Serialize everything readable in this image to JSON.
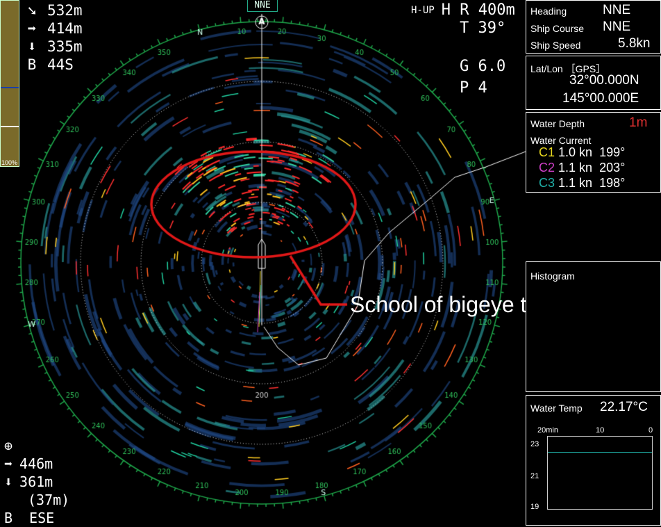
{
  "top_left": {
    "rows": [
      {
        "icon": "diag-arrow-icon",
        "glyph": "➘",
        "value": "532m"
      },
      {
        "icon": "right-arrow-icon",
        "glyph": "➡",
        "value": "414m"
      },
      {
        "icon": "down-arrow-icon",
        "glyph": "⬇",
        "value": "335m"
      },
      {
        "icon": "",
        "glyph": "B",
        "value": "44S"
      }
    ]
  },
  "gain_bar": {
    "percent_label": "100%"
  },
  "top_right": {
    "mode": "H-UP",
    "range_label": "H",
    "range": "R 400m",
    "tilt": "T  39°",
    "gain": "G 6.0",
    "pulse": "P  4"
  },
  "heading_marker": "NNE",
  "bottom_left": {
    "rows": [
      {
        "icon": "crosshair-icon",
        "glyph": "⊕",
        "value": ""
      },
      {
        "icon": "right-arrow-icon",
        "glyph": "➡",
        "value": "446m"
      },
      {
        "icon": "down-arrow-icon",
        "glyph": "⬇",
        "value": "361m"
      },
      {
        "icon": "",
        "glyph": "",
        "value": "(37m)"
      },
      {
        "icon": "",
        "glyph": "B",
        "value": "ESE"
      }
    ]
  },
  "panels": {
    "heading": {
      "label": "Heading",
      "value": "NNE"
    },
    "course": {
      "label": "Ship Course",
      "value": "NNE"
    },
    "speed": {
      "label": "Ship Speed",
      "value": "5.8kn"
    },
    "latlon": {
      "label": "Lat/Lon ［GPS］",
      "lat": "32°00.000N",
      "lon": "145°00.000E"
    },
    "depth": {
      "label": "Water Depth",
      "value": "1m"
    },
    "current": {
      "label": "Water Current",
      "rows": [
        {
          "name": "C1",
          "speed": "1.0 kn",
          "dir": "199°",
          "color": "#e8d820"
        },
        {
          "name": "C2",
          "speed": "1.1 kn",
          "dir": "203°",
          "color": "#d040c8"
        },
        {
          "name": "C3",
          "speed": "1.1 kn",
          "dir": "198°",
          "color": "#20b0a8"
        }
      ]
    },
    "histogram": {
      "label": "Histogram"
    },
    "temp": {
      "label": "Water Temp",
      "value": "22.17°C",
      "x_ticks": [
        "20min",
        "10",
        "0"
      ],
      "y_ticks": [
        "23",
        "21",
        "19"
      ],
      "series_value": 22.17,
      "y_range": [
        19,
        23
      ]
    }
  },
  "annotation": "School of bigeye tuna",
  "compass": {
    "cardinals": [
      [
        "N",
        345
      ],
      [
        "E",
        75
      ],
      [
        "S",
        165
      ],
      [
        "W",
        255
      ]
    ],
    "degrees": [
      "10",
      "20",
      "30",
      "40",
      "50",
      "60",
      "70",
      "80",
      "90",
      "100",
      "110",
      "120",
      "130",
      "140",
      "150",
      "160",
      "170",
      "180",
      "190",
      "200",
      "210",
      "220",
      "230",
      "240",
      "250",
      "260",
      "270",
      "280",
      "290",
      "300",
      "310",
      "320",
      "330",
      "340",
      "350"
    ],
    "range_label": "200",
    "bow_marker": "A"
  },
  "colors": {
    "ring": "#1ea64a",
    "highlight": "#e01818"
  }
}
